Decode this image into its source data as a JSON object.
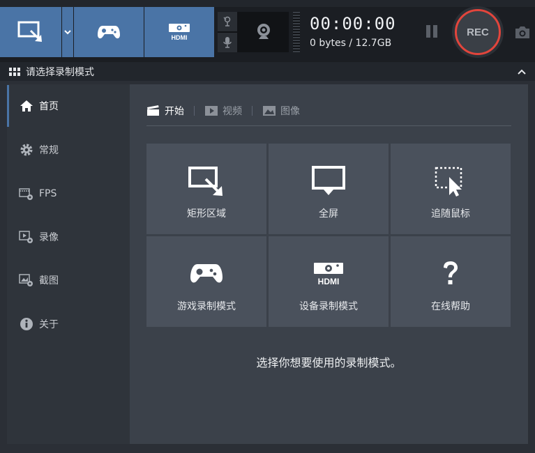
{
  "toolbar": {
    "timer": "00:00:00",
    "storage": "0 bytes / 12.7GB",
    "rec_label": "REC",
    "hdmi_label": "HDMI",
    "colors": {
      "accent": "#4a74a6",
      "rec_ring": "#e2453c"
    }
  },
  "header": {
    "title": "请选择录制模式"
  },
  "sidebar": {
    "items": [
      {
        "label": "首页",
        "icon": "home-icon"
      },
      {
        "label": "常规",
        "icon": "gear-icon"
      },
      {
        "label": "FPS",
        "icon": "fps-icon"
      },
      {
        "label": "录像",
        "icon": "video-settings-icon"
      },
      {
        "label": "截图",
        "icon": "image-settings-icon"
      },
      {
        "label": "关于",
        "icon": "info-icon"
      }
    ]
  },
  "main": {
    "tabs": [
      {
        "label": "开始",
        "icon": "clapper-icon"
      },
      {
        "label": "视频",
        "icon": "play-icon"
      },
      {
        "label": "图像",
        "icon": "picture-icon"
      }
    ],
    "tiles": [
      {
        "label": "矩形区域",
        "icon": "rectangle-area-icon"
      },
      {
        "label": "全屏",
        "icon": "monitor-icon"
      },
      {
        "label": "追随鼠标",
        "icon": "follow-cursor-icon"
      },
      {
        "label": "游戏录制模式",
        "icon": "gamepad-icon"
      },
      {
        "label": "设备录制模式",
        "icon": "hdmi-device-icon"
      },
      {
        "label": "在线帮助",
        "icon": "question-icon"
      }
    ],
    "hint": "选择你想要使用的录制模式。"
  }
}
